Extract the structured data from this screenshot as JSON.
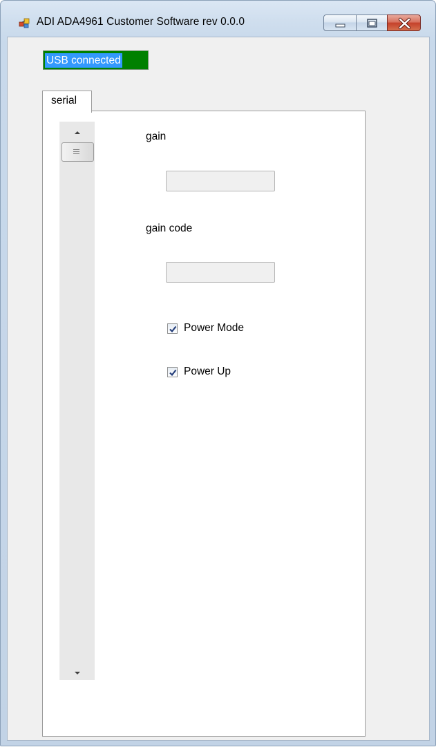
{
  "window": {
    "title": "ADI ADA4961 Customer Software rev 0.0.0",
    "icon": "app-icon",
    "buttons": {
      "minimize": "minimize-icon",
      "maximize": "maximize-icon",
      "close": "close-icon"
    }
  },
  "status": {
    "text": "USB connected",
    "background_color": "#008000",
    "highlight_color": "#3399ff"
  },
  "tabs": [
    {
      "label": "serial",
      "selected": true
    }
  ],
  "form": {
    "gain_label": "gain",
    "gain_value": "",
    "gain_code_label": "gain code",
    "gain_code_value": "",
    "power_mode": {
      "label": "Power Mode",
      "checked": true
    },
    "power_up": {
      "label": "Power Up",
      "checked": true
    }
  },
  "scrollbar": {
    "up_icon": "chevron-up-icon",
    "down_icon": "chevron-down-icon",
    "thumb_icon": "grip-icon"
  }
}
